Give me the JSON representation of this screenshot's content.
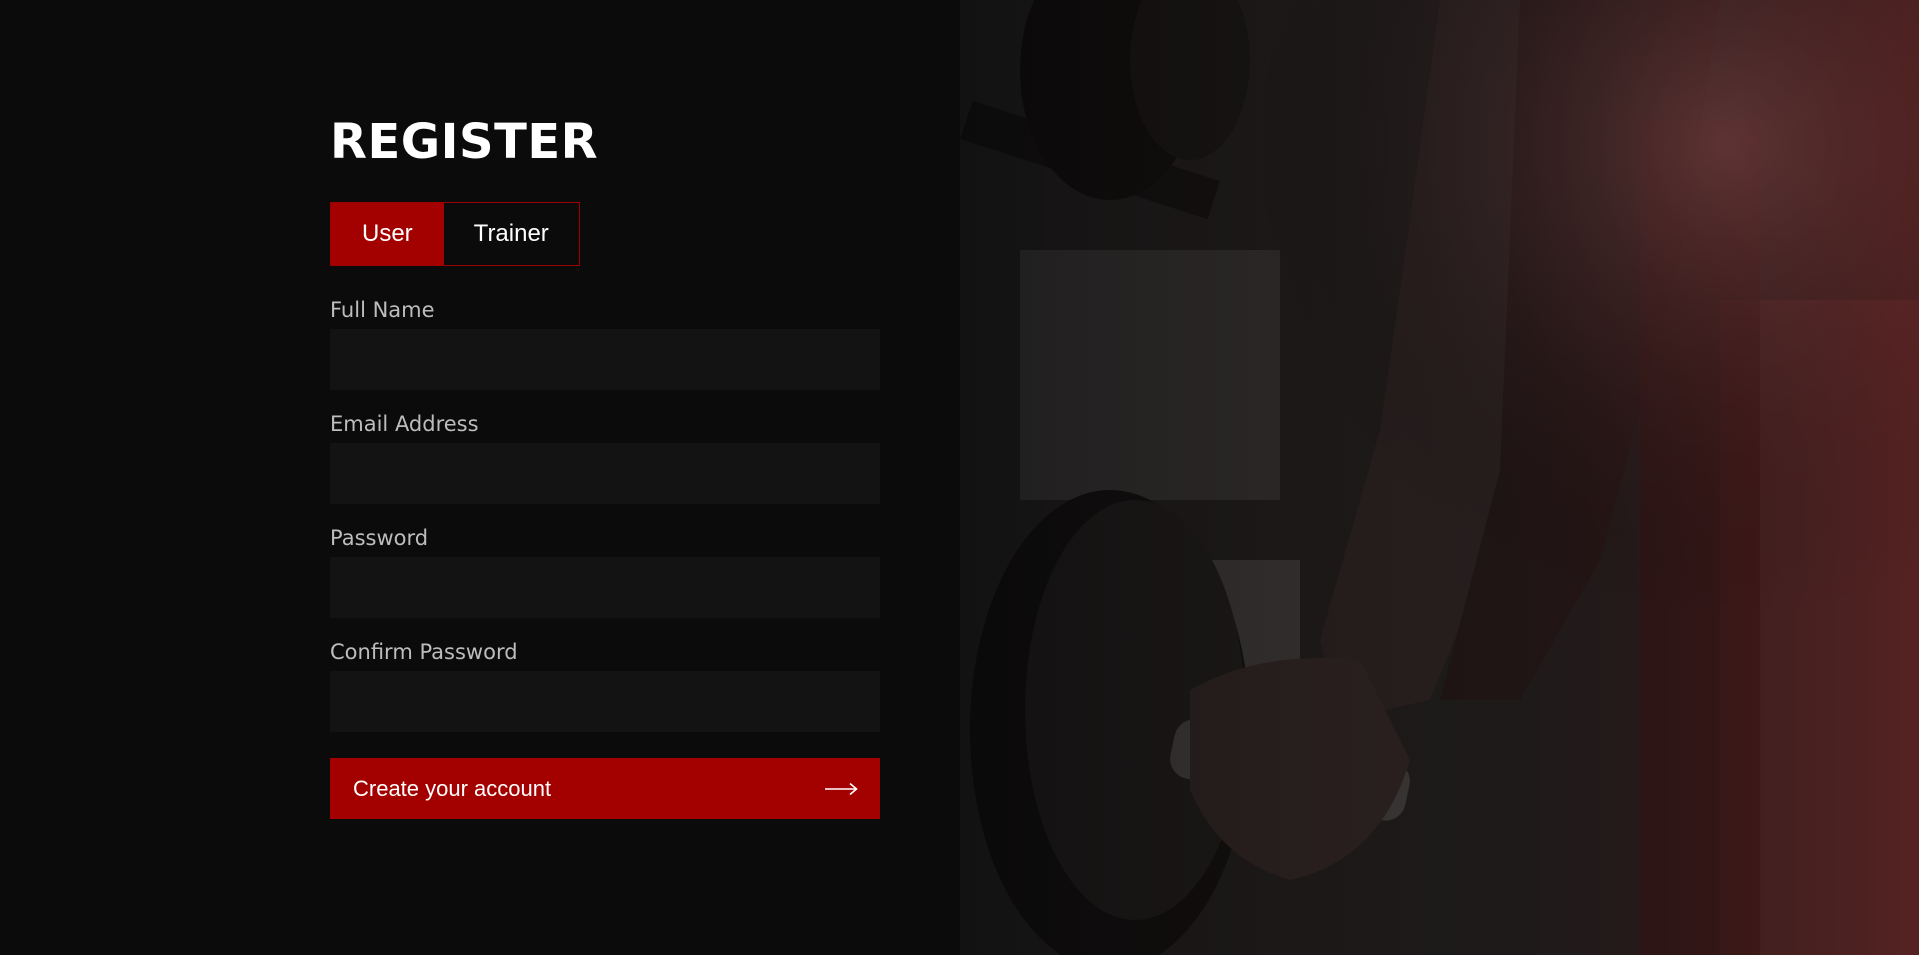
{
  "page": {
    "title": "REGISTER"
  },
  "role_toggle": {
    "options": [
      {
        "label": "User",
        "active": true
      },
      {
        "label": "Trainer",
        "active": false
      }
    ]
  },
  "fields": [
    {
      "label": "Full Name",
      "value": "",
      "placeholder": ""
    },
    {
      "label": "Email Address",
      "value": "",
      "placeholder": ""
    },
    {
      "label": "Password",
      "value": "",
      "placeholder": ""
    },
    {
      "label": "Confirm Password",
      "value": "",
      "placeholder": ""
    }
  ],
  "submit": {
    "label": "Create your account",
    "icon": "arrow-right-icon"
  },
  "hero_image": {
    "subject": "gym-dumbbell-photo"
  },
  "colors": {
    "background": "#0b0b0c",
    "accent": "#a30000",
    "input_bg": "#131314",
    "label": "#bdbdbd"
  }
}
